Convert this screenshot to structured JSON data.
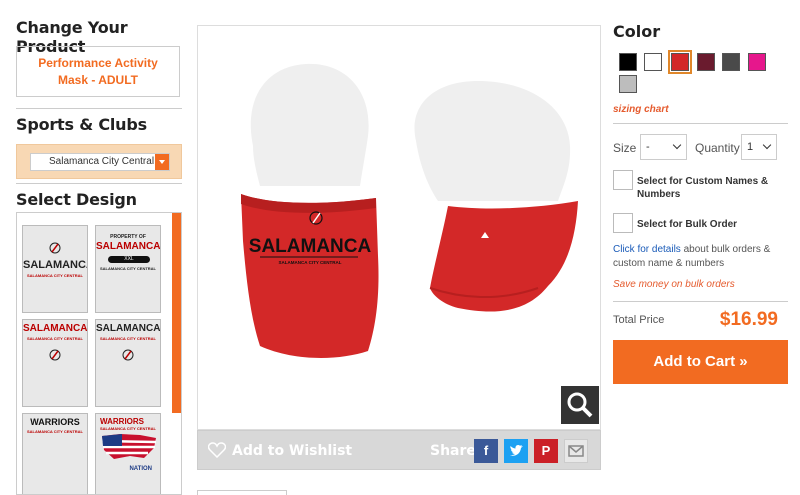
{
  "left": {
    "change_title": "Change Your Product",
    "product_name": "Performance Activity Mask - ADULT",
    "sports_title": "Sports & Clubs",
    "club_selected": "Salamanca City Central",
    "design_title": "Select Design",
    "designs": [
      {
        "line1": "SALAMANCA",
        "line2": "SALAMANCA CITY CENTRAL"
      },
      {
        "line0": "PROPERTY OF",
        "line1": "SALAMANCA",
        "badge": "XXL",
        "line2": "SALAMANCA CITY CENTRAL"
      },
      {
        "line1": "SALAMANCA",
        "line2": "SALAMANCA CITY CENTRAL"
      },
      {
        "line1": "SALAMANCA",
        "line2": "SALAMANCA CITY CENTRAL"
      },
      {
        "line1": "WARRIORS",
        "line2": "SALAMANCA CITY CENTRAL"
      },
      {
        "line1": "WARRIORS",
        "line2": "SALAMANCA CITY CENTRAL",
        "line3": "NATION"
      }
    ]
  },
  "product_image": {
    "mask_text": "SALAMANCA",
    "mask_subtext": "SALAMANCA CITY CENTRAL",
    "mask_color": "#d32828"
  },
  "bar": {
    "wishlist": "Add to Wishlist",
    "share": "Share",
    "facebook": "f",
    "pinterest": "P"
  },
  "right": {
    "color_title": "Color",
    "swatches": [
      "#000000",
      "#ffffff",
      "#d32828",
      "#6a1b2e",
      "#4a4a4a",
      "#e6178c",
      "#bdbdbd"
    ],
    "selected_swatch": 2,
    "sizing_chart": "sizing chart",
    "size_label": "Size",
    "size_value": "-",
    "quantity_label": "Quantity",
    "quantity_value": "1",
    "custom_names": "Select for Custom Names & Numbers",
    "bulk_order": "Select for Bulk Order",
    "details_link": "Click for details",
    "details_text": "about bulk orders & custom name & numbers",
    "save_text": "Save money on bulk orders",
    "total_label": "Total Price",
    "price": "$16.99",
    "add_to_cart": "Add to Cart »"
  },
  "colors": {
    "accent": "#f26b21"
  }
}
